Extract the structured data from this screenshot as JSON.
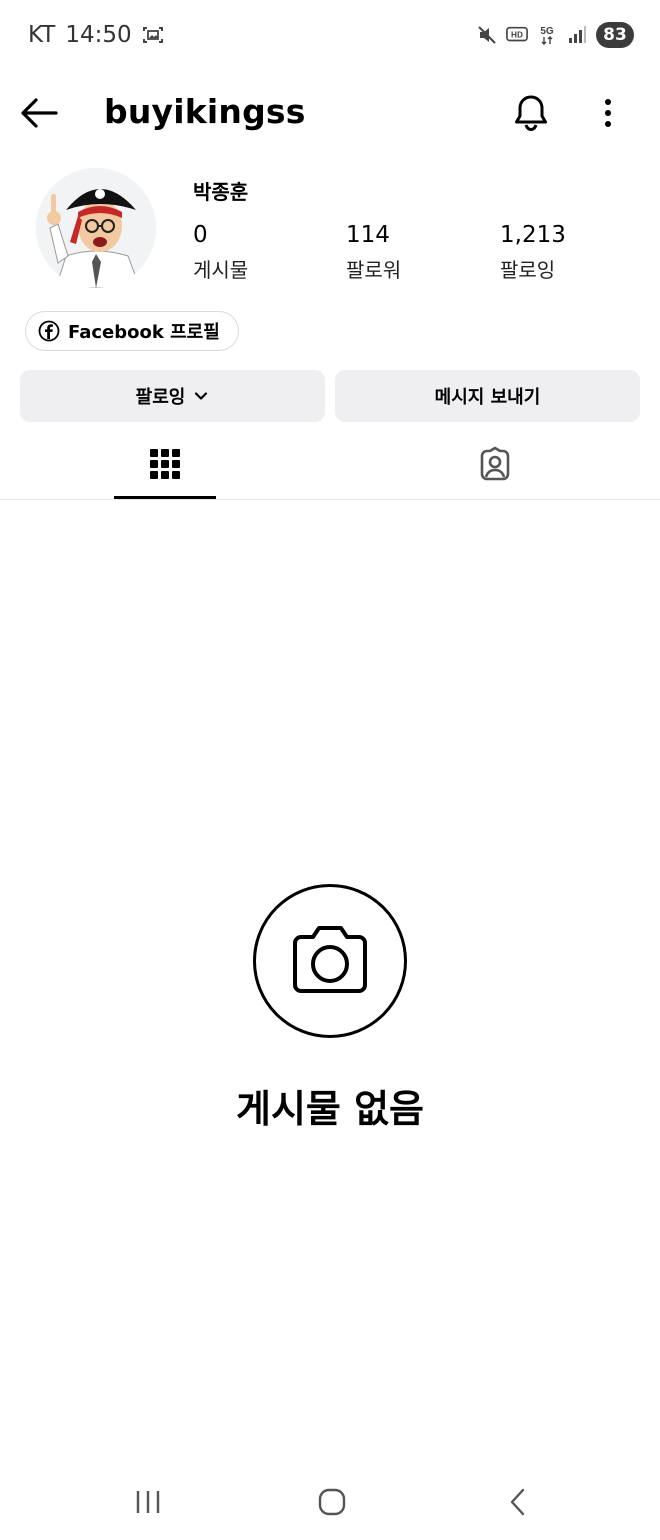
{
  "status_bar": {
    "carrier": "KT",
    "time": "14:50",
    "battery": "83",
    "icons": [
      "gallery-icon",
      "mute-icon",
      "hd-icon",
      "5g-icon",
      "signal-icon",
      "battery-icon"
    ]
  },
  "header": {
    "username": "buyikingss",
    "icons": [
      "back-arrow-icon",
      "bell-icon",
      "more-vertical-icon"
    ]
  },
  "profile": {
    "display_name": "박종훈",
    "stats": [
      {
        "value": "0",
        "label": "게시물"
      },
      {
        "value": "114",
        "label": "팔로워"
      },
      {
        "value": "1,213",
        "label": "팔로잉"
      }
    ],
    "facebook_chip": "Facebook 프로필"
  },
  "actions": {
    "following_label": "팔로잉",
    "message_label": "메시지 보내기"
  },
  "tabs": {
    "items": [
      "grid-icon",
      "tagged-icon"
    ],
    "active": 0
  },
  "empty_state": {
    "title": "게시물 없음",
    "icon": "camera-icon"
  },
  "nav_bar": {
    "icons": [
      "recents-icon",
      "home-icon",
      "back-icon"
    ]
  }
}
